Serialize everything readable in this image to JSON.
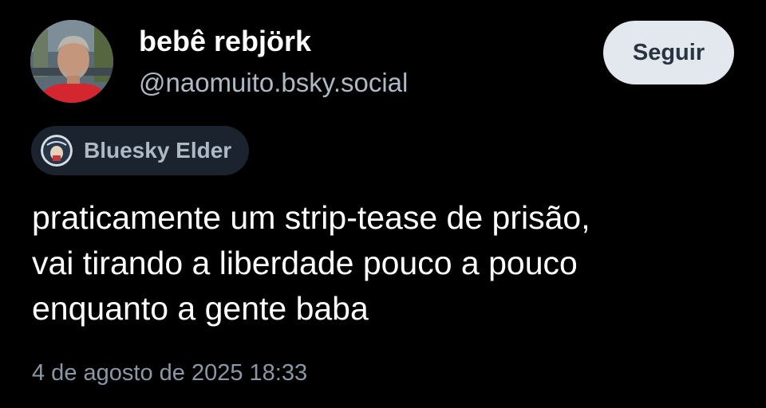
{
  "author": {
    "display_name": "bebê rebjörk",
    "handle": "@naomuito.bsky.social"
  },
  "follow_button": {
    "label": "Seguir"
  },
  "badge": {
    "label": "Bluesky Elder"
  },
  "post": {
    "lines": [
      "praticamente um strip-tease de prisão,",
      "vai tirando a liberdade pouco a pouco",
      "enquanto a gente baba"
    ],
    "timestamp": "4 de agosto de 2025 18:33"
  },
  "colors": {
    "background": "#000000",
    "text_primary": "#ffffff",
    "text_secondary": "#aeb9c6",
    "timestamp": "#8a97a6",
    "button_bg": "#e3e8ee",
    "button_text": "#2a3440",
    "badge_bg": "#1b232e"
  }
}
